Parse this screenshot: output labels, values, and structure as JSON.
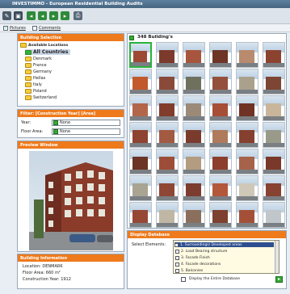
{
  "title_bar": {
    "title": "INVESTIMMO - European Residential Building Audits"
  },
  "toolbar": {
    "buttons": [
      {
        "icon": "pencil-icon"
      },
      {
        "icon": "save-icon"
      },
      {
        "icon": "first-icon"
      },
      {
        "icon": "prev-icon"
      },
      {
        "icon": "next-icon"
      },
      {
        "icon": "last-icon"
      },
      {
        "icon": "print-icon"
      }
    ]
  },
  "options": {
    "pictures_label": "Pictures",
    "comments_label": "Comments"
  },
  "building_selection": {
    "heading": "Building Selection",
    "root_label": "Available Locations",
    "items": [
      {
        "label": "All Countries",
        "selected": true
      },
      {
        "label": "Denmark"
      },
      {
        "label": "France"
      },
      {
        "label": "Germany"
      },
      {
        "label": "Hellas"
      },
      {
        "label": "Italy"
      },
      {
        "label": "Poland"
      },
      {
        "label": "Switzerland"
      }
    ]
  },
  "filter": {
    "heading": "Filter: [Construction Year] [Area]",
    "year_label": "Year:",
    "year_value": "None",
    "floor_label": "Floor Area:",
    "floor_value": "None"
  },
  "preview": {
    "heading": "Preview Window"
  },
  "building_info": {
    "heading": "Building Information",
    "location": "Location: DENMARK",
    "floor_area": "Floor Area: 660 m²",
    "construction_year": "Construction Year: 1912"
  },
  "results": {
    "count_label": "348 Building's"
  },
  "display_database": {
    "heading": "Display Database",
    "select_label": "Select Elements:",
    "elements": [
      {
        "label": "1. Surroundings/ Developed areas",
        "selected": true
      },
      {
        "label": "2. Load Bearing structure"
      },
      {
        "label": "3. Facade Finish"
      },
      {
        "label": "4. Facade decorations"
      },
      {
        "label": "5. Balconies"
      }
    ],
    "entire_label": "Display the Entire Database"
  },
  "colors": {
    "accent": "#ee7a1c",
    "green": "#37a936",
    "titlebar": "#4f6f8d",
    "selection": "#2d4e8f"
  }
}
